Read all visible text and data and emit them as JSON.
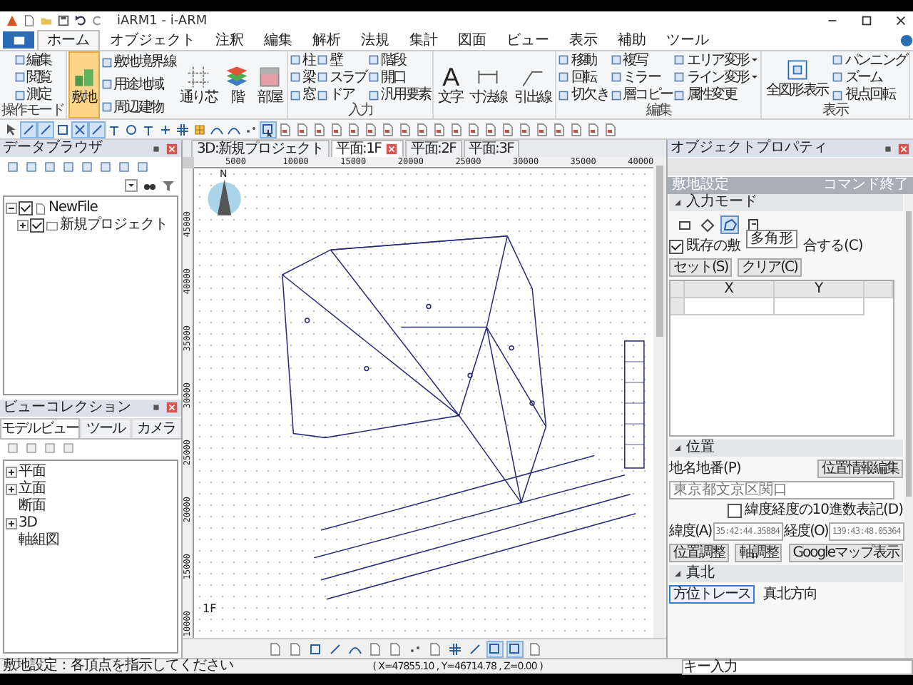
{
  "window": {
    "title": "iARM1 - i-ARM"
  },
  "menu_tabs": [
    {
      "label": "ホーム",
      "selected": true
    },
    {
      "label": "オブジェクト",
      "selected": false
    },
    {
      "label": "注釈",
      "selected": false
    },
    {
      "label": "編集",
      "selected": false
    },
    {
      "label": "解析",
      "selected": false
    },
    {
      "label": "法規",
      "selected": false
    },
    {
      "label": "集計",
      "selected": false
    },
    {
      "label": "図面",
      "selected": false
    },
    {
      "label": "ビュー",
      "selected": false
    },
    {
      "label": "表示",
      "selected": false
    },
    {
      "label": "補助",
      "selected": false
    },
    {
      "label": "ツール",
      "selected": false
    }
  ],
  "ribbon": [
    {
      "label": "操作モード",
      "items": [
        {
          "kind": "stack",
          "commands": [
            {
              "label": "編集"
            },
            {
              "label": "閲覧"
            },
            {
              "label": "測定"
            }
          ]
        }
      ]
    },
    {
      "items": [
        {
          "kind": "large",
          "label": "敷地",
          "selected": true
        },
        {
          "kind": "stack",
          "commands": [
            {
              "label": "敷地境界線"
            },
            {
              "label": "用途地域"
            },
            {
              "label": "周辺建物"
            }
          ]
        },
        {
          "kind": "large",
          "label": "通り芯",
          "selected": false
        },
        {
          "kind": "large",
          "label": "階",
          "selected": false
        },
        {
          "kind": "large",
          "label": "部屋",
          "selected": false
        }
      ]
    },
    {
      "label": "入力",
      "items": [
        {
          "kind": "stack",
          "commands": [
            {
              "label": "柱"
            },
            {
              "label": "梁"
            },
            {
              "label": "窓"
            }
          ]
        },
        {
          "kind": "stack",
          "commands": [
            {
              "label": "壁"
            },
            {
              "label": "スラブ"
            },
            {
              "label": "ドア"
            }
          ]
        },
        {
          "kind": "stack",
          "commands": [
            {
              "label": "階段"
            },
            {
              "label": "開口"
            },
            {
              "label": "汎用要素"
            }
          ]
        }
      ]
    },
    {
      "items": [
        {
          "kind": "large",
          "glyph": "A",
          "label": "文字",
          "selected": false
        },
        {
          "kind": "large",
          "label": "寸法線",
          "selected": false
        },
        {
          "kind": "large",
          "label": "引出線",
          "selected": false
        }
      ]
    },
    {
      "label": "編集",
      "items": [
        {
          "kind": "stack",
          "commands": [
            {
              "label": "移動"
            },
            {
              "label": "回転"
            },
            {
              "label": "切欠き"
            }
          ]
        },
        {
          "kind": "stack",
          "commands": [
            {
              "label": "複写"
            },
            {
              "label": "ミラー"
            },
            {
              "label": "層コピー"
            }
          ]
        },
        {
          "kind": "stack",
          "commands": [
            {
              "label": "エリア変形",
              "dropdown": true
            },
            {
              "label": "ライン変形",
              "dropdown": true
            },
            {
              "label": "属性変更"
            }
          ]
        }
      ]
    },
    {
      "label": "表示",
      "items": [
        {
          "kind": "large",
          "label": "全図形表示",
          "selected": false
        },
        {
          "kind": "stack",
          "commands": [
            {
              "label": "パンニング"
            },
            {
              "label": "ズーム"
            },
            {
              "label": "視点回転"
            }
          ]
        }
      ]
    }
  ],
  "data_browser": {
    "title": "データブラウザ",
    "tree": [
      {
        "label": "NewFile",
        "checked": true,
        "expanded": true,
        "children": [
          {
            "label": "新規プロジェクト",
            "checked": true,
            "expanded": false
          }
        ]
      }
    ]
  },
  "view_collection": {
    "title": "ビューコレクション",
    "tabs": [
      {
        "label": "モデルビュー",
        "selected": true
      },
      {
        "label": "ツール",
        "selected": false
      },
      {
        "label": "カメラ",
        "selected": false
      }
    ],
    "tree": [
      {
        "label": "平面",
        "expandable": true
      },
      {
        "label": "立面",
        "expandable": true
      },
      {
        "label": "断面",
        "expandable": false
      },
      {
        "label": "3D",
        "expandable": true
      },
      {
        "label": "軸組図",
        "expandable": false
      }
    ]
  },
  "document_tabs": [
    {
      "label": "3D:新規プロジェクト",
      "selected": false,
      "closable": false
    },
    {
      "label": "平面:1F",
      "selected": true,
      "closable": true
    },
    {
      "label": "平面:2F",
      "selected": false,
      "closable": false
    },
    {
      "label": "平面:3F",
      "selected": false,
      "closable": false
    }
  ],
  "canvas": {
    "x_ruler": [
      "5000",
      "10000",
      "15000",
      "20000",
      "25000",
      "30000",
      "35000",
      "40000"
    ],
    "y_ruler": [
      "45000",
      "40000",
      "35000",
      "30000",
      "25000",
      "20000",
      "15000",
      "10000"
    ],
    "north_label": "N",
    "floor_label": "1F"
  },
  "properties": {
    "title": "オブジェクトプロパティ",
    "command": "敷地設定",
    "end_command": "コマンド終了",
    "input_mode": {
      "title": "入力モード",
      "shapes": [
        {
          "kind": "rectangle",
          "selected": false
        },
        {
          "kind": "diamond",
          "selected": false
        },
        {
          "kind": "polygon",
          "selected": true
        },
        {
          "kind": "trace",
          "selected": false
        }
      ],
      "tooltip": "多角形",
      "merge_checkbox": {
        "label_start": "既存の敷",
        "label_end": "合する(C)",
        "checked": true
      },
      "buttons": [
        "セット(S)",
        "クリア(C)"
      ],
      "table_columns": [
        "X",
        "Y"
      ]
    },
    "location": {
      "title": "位置",
      "address_label": "地名地番(P)",
      "edit_button": "位置情報編集",
      "address": "東京都文京区関口",
      "decimal_checkbox": {
        "label": "緯度経度の10進数表記(D)",
        "checked": false
      },
      "latitude_label": "緯度(A)",
      "latitude": "35:42:44.35884",
      "longitude_label": "経度(O)",
      "longitude": "139:43:48.05364",
      "buttons": [
        "位置調整",
        "軸調整",
        "Googleマップ表示"
      ]
    },
    "true_north": {
      "title": "真北",
      "button": "方位トレース",
      "direction_label": "真北方向"
    }
  },
  "status_bar": {
    "message": "敷地設定：各頂点を指示してください",
    "coordinates": "( X=47855.10 , Y=46714.78 , Z=0.00 )",
    "key_input_label": "キー入力"
  }
}
